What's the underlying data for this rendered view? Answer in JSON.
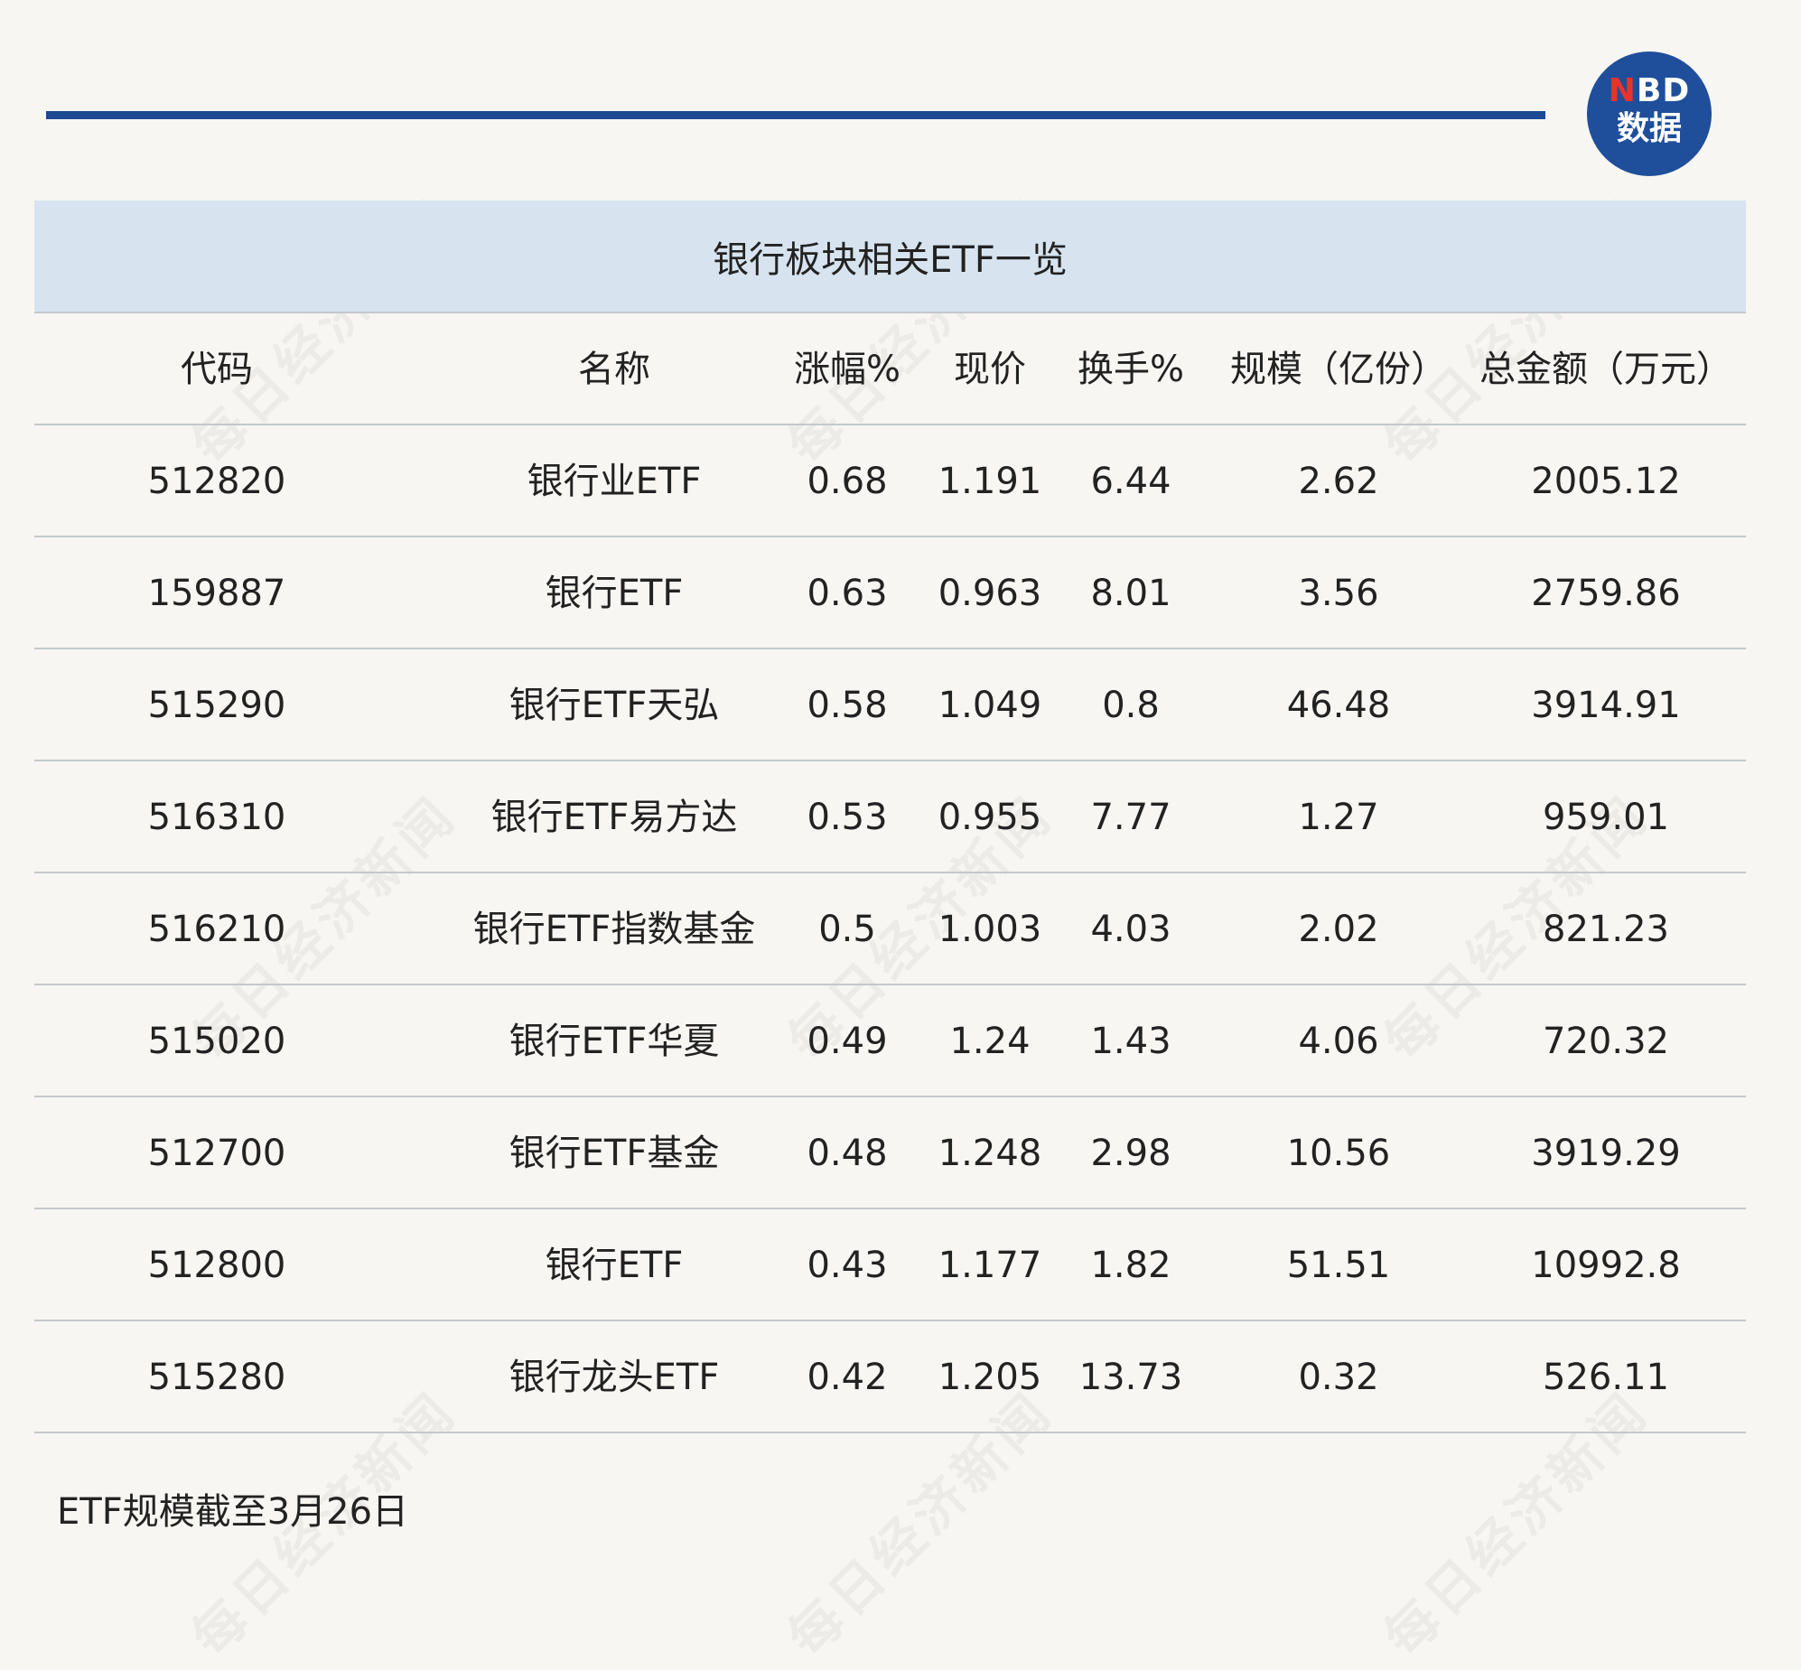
{
  "logo": {
    "line1_n": "N",
    "line1_rest": "BD",
    "line2": "数据"
  },
  "watermark_text": "每日经济新闻",
  "table": {
    "title": "银行板块相关ETF一览",
    "headers": [
      "代码",
      "名称",
      "涨幅%",
      "现价",
      "换手%",
      "规模（亿份）",
      "总金额（万元）"
    ],
    "rows": [
      [
        "512820",
        "银行业ETF",
        "0.68",
        "1.191",
        "6.44",
        "2.62",
        "2005.12"
      ],
      [
        "159887",
        "银行ETF",
        "0.63",
        "0.963",
        "8.01",
        "3.56",
        "2759.86"
      ],
      [
        "515290",
        "银行ETF天弘",
        "0.58",
        "1.049",
        "0.8",
        "46.48",
        "3914.91"
      ],
      [
        "516310",
        "银行ETF易方达",
        "0.53",
        "0.955",
        "7.77",
        "1.27",
        "959.01"
      ],
      [
        "516210",
        "银行ETF指数基金",
        "0.5",
        "1.003",
        "4.03",
        "2.02",
        "821.23"
      ],
      [
        "515020",
        "银行ETF华夏",
        "0.49",
        "1.24",
        "1.43",
        "4.06",
        "720.32"
      ],
      [
        "512700",
        "银行ETF基金",
        "0.48",
        "1.248",
        "2.98",
        "10.56",
        "3919.29"
      ],
      [
        "512800",
        "银行ETF",
        "0.43",
        "1.177",
        "1.82",
        "51.51",
        "10992.8"
      ],
      [
        "515280",
        "银行龙头ETF",
        "0.42",
        "1.205",
        "13.73",
        "0.32",
        "526.11"
      ]
    ]
  },
  "footnote": "ETF规模截至3月26日",
  "colors": {
    "background": "#f8f6f2",
    "title_band": "#d7e4f0",
    "rule": "#1d4a93",
    "logo_bg": "#1f4f9b",
    "logo_accent": "#e8332a",
    "divider": "#c4c8cc"
  }
}
